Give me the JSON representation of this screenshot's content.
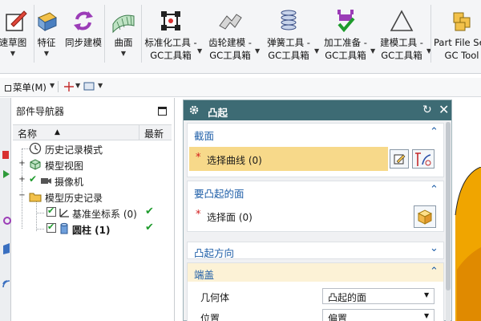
{
  "ribbon": {
    "items": [
      {
        "label1": "速草图",
        "label2": "",
        "icon": "sketch-icon"
      },
      {
        "label1": "特征",
        "label2": "",
        "icon": "feature-icon"
      },
      {
        "label1": "同步建模",
        "label2": "",
        "icon": "sync-modeling-icon"
      },
      {
        "label1": "曲面",
        "label2": "",
        "icon": "surface-icon"
      },
      {
        "label1": "标准化工具 -",
        "label2": "GC工具箱",
        "icon": "standard-tools-icon"
      },
      {
        "label1": "齿轮建模 -",
        "label2": "GC工具箱",
        "icon": "gear-modeling-icon"
      },
      {
        "label1": "弹簧工具 -",
        "label2": "GC工具箱",
        "icon": "spring-tool-icon"
      },
      {
        "label1": "加工准备 -",
        "label2": "GC工具箱",
        "icon": "machining-prep-icon"
      },
      {
        "label1": "建模工具 -",
        "label2": "GC工具箱",
        "icon": "modeling-tool-icon"
      },
      {
        "label1": "Part File Sec",
        "label2": "GC Tool",
        "icon": "part-file-icon"
      }
    ]
  },
  "quickbar": {
    "menu_label": "菜单(M)"
  },
  "navigator": {
    "title": "部件导航器",
    "col_name": "名称",
    "col_latest": "最新",
    "rows": [
      {
        "label": "历史记录模式",
        "icon": "clock-icon"
      },
      {
        "label": "模型视图",
        "icon": "model-view-icon"
      },
      {
        "label": "摄像机",
        "icon": "camera-icon"
      },
      {
        "label": "模型历史记录",
        "icon": "folder-icon"
      },
      {
        "label": "基准坐标系 (0)",
        "icon": "datum-csys-icon"
      },
      {
        "label": "圆柱 (1)",
        "icon": "cylinder-icon"
      }
    ]
  },
  "dialog": {
    "title": "凸起",
    "sections": {
      "section_curve": {
        "title": "截面",
        "select_text": "选择曲线 (0)"
      },
      "face": {
        "title": "要凸起的面",
        "select_text": "选择面 (0)"
      },
      "direction": {
        "title": "凸起方向"
      },
      "cap": {
        "title": "端盖",
        "geometry_label": "几何体",
        "geometry_value": "凸起的面",
        "position_label": "位置",
        "position_value": "偏置"
      }
    }
  },
  "colors": {
    "title_bar": "#3d6b74",
    "highlight": "#f7d98a",
    "section_header": "#1f5fa8",
    "model_orange": "#f0a500"
  }
}
